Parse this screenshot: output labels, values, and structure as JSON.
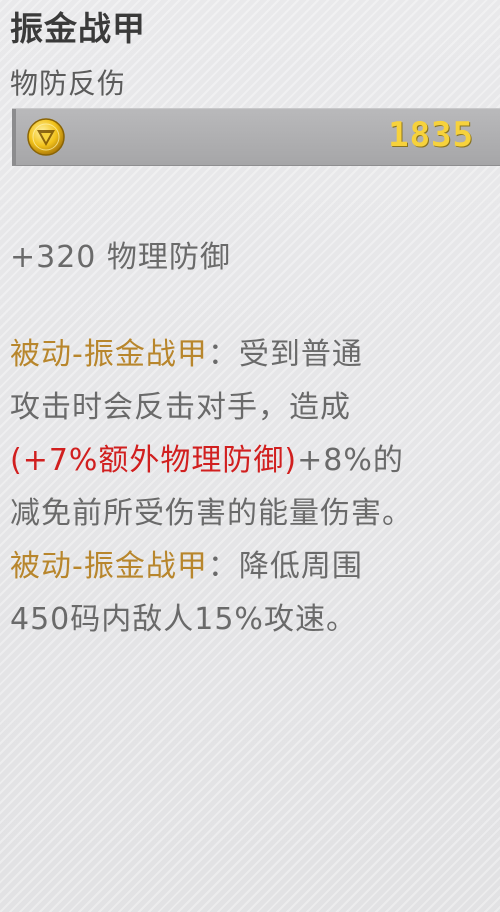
{
  "item": {
    "name": "振金战甲",
    "category": "物防反伤",
    "price": "1835",
    "price_icon": "gold-coin-icon"
  },
  "stats": {
    "physical_defense": "+320 物理防御"
  },
  "passives": {
    "p1_name": "被动-振金战甲",
    "p1_sep": "：",
    "p1_text_a": "受到普通",
    "p1_text_b": "攻击时会反击对手，造成",
    "p1_highlight": "(+7%额外物理防御)",
    "p1_text_c": "+8%的",
    "p1_text_d": "减免前所受伤害的能量伤害。",
    "p2_name": "被动-振金战甲",
    "p2_sep": "：",
    "p2_text_a": "降低周围",
    "p2_text_b": "450码内敌人15%攻速。"
  },
  "colors": {
    "passive_name": "#b8862c",
    "highlight": "#d11f1f",
    "price": "#f7d23c"
  }
}
